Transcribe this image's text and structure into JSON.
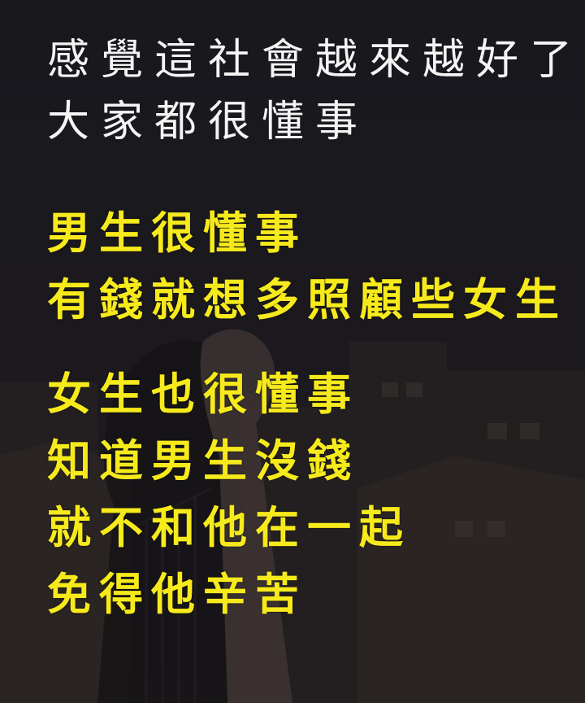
{
  "intro": {
    "line1": "感覺這社會越來越好了",
    "line2": "大家都很懂事"
  },
  "stanza1": {
    "line1": "男生很懂事",
    "line2": "有錢就想多照顧些女生"
  },
  "stanza2": {
    "line1": "女生也很懂事",
    "line2": "知道男生沒錢",
    "line3": "就不和他在一起",
    "line4": "免得他辛苦"
  },
  "colors": {
    "intro_text": "#f4f4f4",
    "highlight_text": "#f6ea1c",
    "background": "#1a1a20"
  }
}
